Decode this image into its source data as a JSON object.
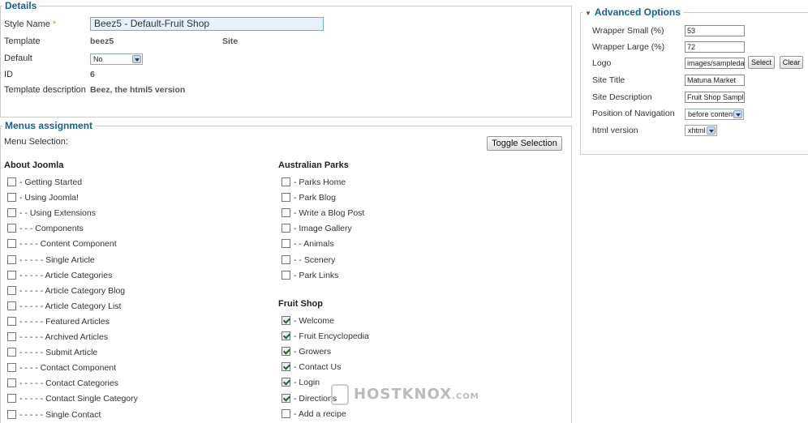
{
  "details": {
    "legend": "Details",
    "style_name_label": "Style Name",
    "style_name_required": "*",
    "style_name_value": "Beez5 - Default-Fruit Shop",
    "template_label": "Template",
    "template_value": "beez5",
    "template_site": "Site",
    "default_label": "Default",
    "default_value": "No",
    "id_label": "ID",
    "id_value": "6",
    "description_label": "Template description",
    "description_value": "Beez, the html5 version"
  },
  "menus": {
    "legend": "Menus assignment",
    "selection_label": "Menu Selection:",
    "toggle_button": "Toggle Selection",
    "about": {
      "title": "About Joomla",
      "items": [
        {
          "label": "- Getting Started",
          "checked": false
        },
        {
          "label": "- Using Joomla!",
          "checked": false
        },
        {
          "label": "- - Using Extensions",
          "checked": false
        },
        {
          "label": "- - - Components",
          "checked": false
        },
        {
          "label": "- - - - Content Component",
          "checked": false
        },
        {
          "label": "- - - - - Single Article",
          "checked": false
        },
        {
          "label": "- - - - - Article Categories",
          "checked": false
        },
        {
          "label": "- - - - - Article Category Blog",
          "checked": false
        },
        {
          "label": "- - - - - Article Category List",
          "checked": false
        },
        {
          "label": "- - - - - Featured Articles",
          "checked": false
        },
        {
          "label": "- - - - - Archived Articles",
          "checked": false
        },
        {
          "label": "- - - - - Submit Article",
          "checked": false
        },
        {
          "label": "- - - - Contact Component",
          "checked": false
        },
        {
          "label": "- - - - - Contact Categories",
          "checked": false
        },
        {
          "label": "- - - - - Contact Single Category",
          "checked": false
        },
        {
          "label": "- - - - - Single Contact",
          "checked": false
        }
      ]
    },
    "parks": {
      "title": "Australian Parks",
      "items": [
        {
          "label": "- Parks Home",
          "checked": false
        },
        {
          "label": "- Park Blog",
          "checked": false
        },
        {
          "label": "- Write a Blog Post",
          "checked": false
        },
        {
          "label": "- Image Gallery",
          "checked": false
        },
        {
          "label": "- - Animals",
          "checked": false
        },
        {
          "label": "- - Scenery",
          "checked": false
        },
        {
          "label": "- Park Links",
          "checked": false
        }
      ]
    },
    "fruit": {
      "title": "Fruit Shop",
      "items": [
        {
          "label": "- Welcome",
          "checked": true
        },
        {
          "label": "- Fruit Encyclopedia",
          "checked": true
        },
        {
          "label": "- Growers",
          "checked": true
        },
        {
          "label": "- Contact Us",
          "checked": true
        },
        {
          "label": "- Login",
          "checked": true
        },
        {
          "label": "- Directions",
          "checked": true
        },
        {
          "label": "- Add a recipe",
          "checked": false
        }
      ]
    }
  },
  "advanced": {
    "legend": "Advanced Options",
    "wrapper_small_label": "Wrapper Small (%)",
    "wrapper_small_value": "53",
    "wrapper_large_label": "Wrapper Large (%)",
    "wrapper_large_value": "72",
    "logo_label": "Logo",
    "logo_value": "images/sampledata/f",
    "select_button": "Select",
    "clear_button": "Clear",
    "site_title_label": "Site Title",
    "site_title_value": "Matuna Market",
    "site_description_label": "Site Description",
    "site_description_value": "Fruit Shop Sample S",
    "nav_position_label": "Position of Navigation",
    "nav_position_value": "before content",
    "html_version_label": "html version",
    "html_version_value": "xhtml"
  },
  "watermark": {
    "text": "HOSTKNOX",
    "suffix": ".COM"
  }
}
